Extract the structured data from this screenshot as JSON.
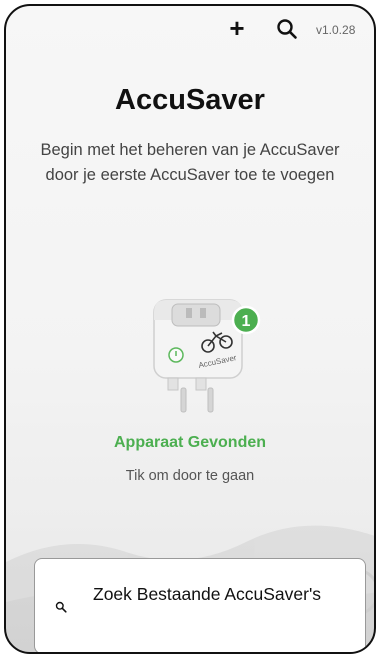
{
  "header": {
    "add_icon": "plus-icon",
    "search_icon": "search-icon",
    "version": "v1.0.28"
  },
  "main": {
    "title": "AccuSaver",
    "subtitle": "Begin met het beheren van je AccuSaver door je eerste AccuSaver toe te voegen",
    "device": {
      "brand_text": "AccuSaver",
      "badge_count": "1"
    },
    "found_label": "Apparaat Gevonden",
    "tap_hint": "Tik om door te gaan"
  },
  "search_card": {
    "label": "Zoek Bestaande AccuSaver's",
    "icon": "search-icon"
  },
  "colors": {
    "accent_green": "#4caf50",
    "text_dark": "#111111"
  }
}
